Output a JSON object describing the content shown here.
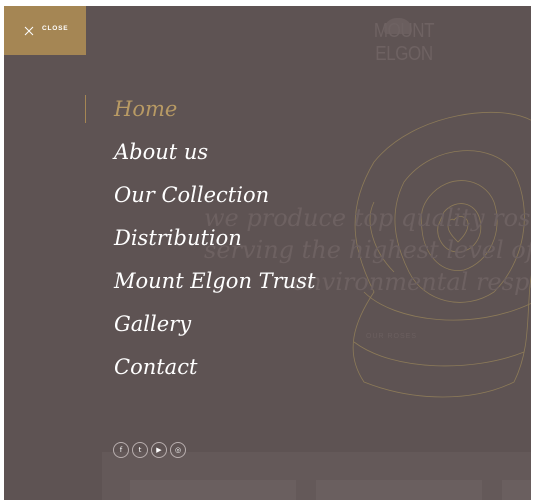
{
  "close": {
    "label": "CLOSE"
  },
  "background": {
    "logo": "MOUNT ELGON",
    "tagline": [
      "we produce top quality roses",
      "serving the highest level of so",
      "environmental responsibil"
    ],
    "small_link": "OUR ROSES"
  },
  "nav": {
    "items": [
      {
        "label": "Home",
        "active": true
      },
      {
        "label": "About us"
      },
      {
        "label": "Our Collection"
      },
      {
        "label": "Distribution"
      },
      {
        "label": "Mount Elgon Trust"
      },
      {
        "label": "Gallery"
      },
      {
        "label": "Contact"
      }
    ]
  },
  "social": [
    {
      "icon": "facebook-icon",
      "glyph": "f"
    },
    {
      "icon": "twitter-icon",
      "glyph": "t"
    },
    {
      "icon": "youtube-icon",
      "glyph": "▶"
    },
    {
      "icon": "instagram-icon",
      "glyph": "◎"
    }
  ],
  "colors": {
    "overlay": "#5e5353",
    "accent": "#a58654",
    "active": "#b89a64"
  }
}
